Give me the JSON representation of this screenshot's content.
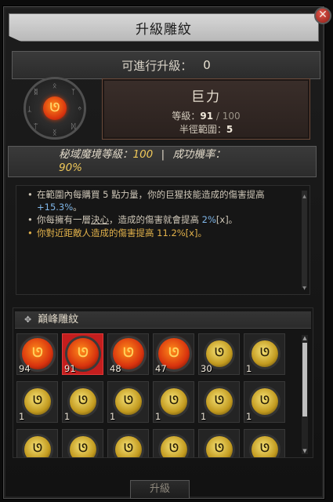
{
  "window": {
    "title": "升級雕紋",
    "close_icon": "close-icon"
  },
  "upgrades": {
    "label": "可進行升級：",
    "value": "0"
  },
  "glyph": {
    "symbol": "ᘎ",
    "name": "巨力",
    "level_label": "等級：",
    "level_value": "91",
    "level_max": " / 100",
    "radius_label": "半徑範圍：",
    "radius_value": "5"
  },
  "dungeon": {
    "label": "秘域魔境等級：",
    "level": "100",
    "sep": "|",
    "rate_label": "成功機率：",
    "rate": "90%"
  },
  "description": {
    "line1_a": "在範圍內每購買 5 點力量，你的巨猩技能造成的傷害提高 ",
    "line1_num": "+15.3%",
    "line1_b": "。",
    "line2_a": "你每擁有一層",
    "line2_u": "決心",
    "line2_b": "，造成的傷害就會提高 ",
    "line2_num": "2%",
    "line2_c": "[x]。",
    "line3": "你對近距敵人造成的傷害提高 11.2%[x]。"
  },
  "paragon": {
    "header": "巔峰雕紋",
    "cells": [
      {
        "type": "red",
        "level": "94",
        "selected": false
      },
      {
        "type": "red",
        "level": "91",
        "selected": true
      },
      {
        "type": "red",
        "level": "48",
        "selected": false
      },
      {
        "type": "red",
        "level": "47",
        "selected": false
      },
      {
        "type": "gold",
        "level": "30",
        "selected": false
      },
      {
        "type": "gold",
        "level": "1",
        "selected": false
      },
      {
        "type": "gold",
        "level": "1",
        "selected": false
      },
      {
        "type": "gold",
        "level": "1",
        "selected": false
      },
      {
        "type": "gold",
        "level": "1",
        "selected": false
      },
      {
        "type": "gold",
        "level": "1",
        "selected": false
      },
      {
        "type": "gold",
        "level": "1",
        "selected": false
      },
      {
        "type": "gold",
        "level": "1",
        "selected": false
      },
      {
        "type": "gold",
        "level": "",
        "selected": false
      },
      {
        "type": "gold",
        "level": "",
        "selected": false
      },
      {
        "type": "gold",
        "level": "",
        "selected": false
      },
      {
        "type": "gold",
        "level": "",
        "selected": false
      },
      {
        "type": "gold",
        "level": "",
        "selected": false
      },
      {
        "type": "gold",
        "level": "",
        "selected": false
      }
    ]
  },
  "footer": {
    "upgrade_label": "升級"
  },
  "colors": {
    "accent_red": "#c41e1e",
    "gold_text": "#e3b24b",
    "value_blue": "#7fb6e8"
  }
}
